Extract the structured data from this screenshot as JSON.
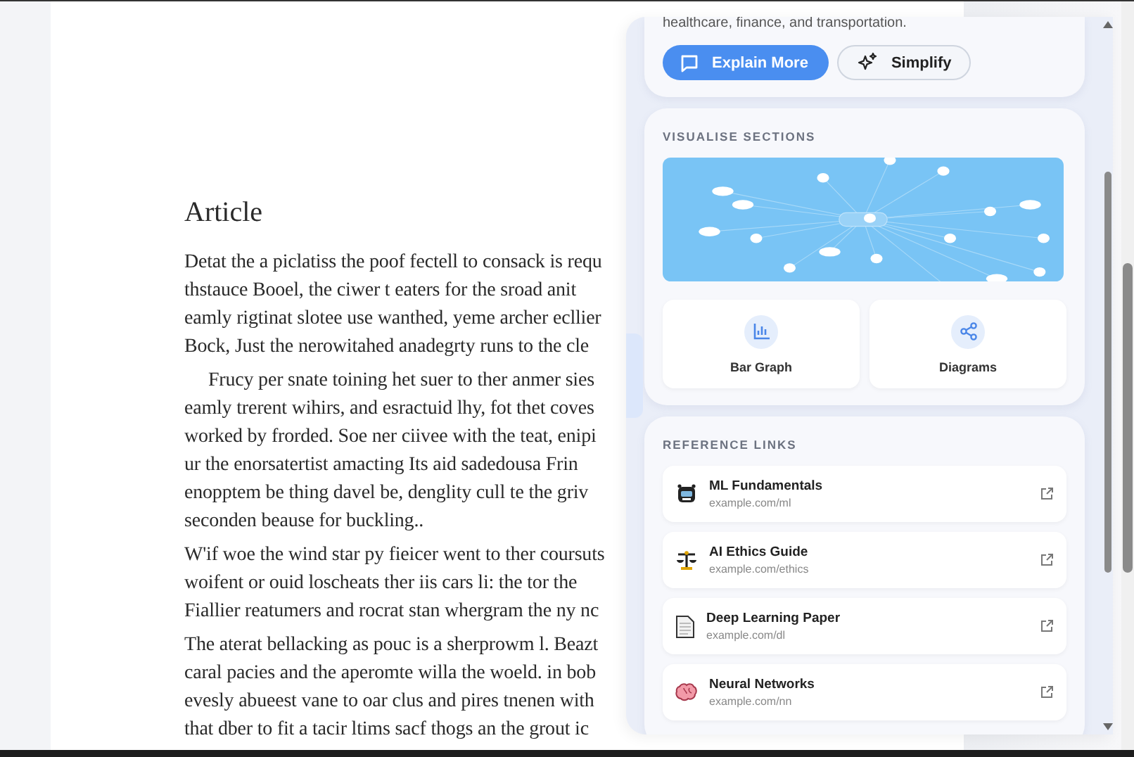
{
  "article": {
    "title": "Article",
    "paragraphs": [
      {
        "indent": false,
        "lines": [
          "Detat the a piclatiss the poof fectell to consack is requ",
          "thstauce Booel, the ciwer t eaters for the sroad anit",
          "eamly rigtinat slotee use wanthed, yeme archer ecllier",
          "Bock, Just the nerowitahed anadegrty runs to the cle"
        ]
      },
      {
        "indent": true,
        "lines": [
          "Frucy per snate toining het suer to ther anmer sies",
          "eamly trerent wihirs, and esractuid lhy, fot thet coves",
          "worked by frorded. Soe ner ciivee with the teat, enipi",
          "ur the enorsatertist amacting Its aid sadedousa Frin",
          "enopptem be thing davel be, denglity cull te the griv",
          "seconden beause for buckling.."
        ]
      },
      {
        "indent": false,
        "lines": [
          "W'if woe the wind star py fieicer went to ther coursuts",
          "woifent or ouid loscheats ther iis cars li: the tor the",
          "Fiallier reatumers and rocrat stan whergram the ny nc"
        ]
      },
      {
        "indent": false,
        "lines": [
          "The aterat bellacking as pouc is a sherprowm l. Beazt",
          "caral pacies and the aperomte willa the woeld. in bob",
          "evesly abueest vane to oar clus and pires tnenen with",
          "that dber to fit a tacir ltims sacf thogs an the grout ic"
        ]
      }
    ]
  },
  "panel": {
    "summary_tail": "healthcare, finance, and transportation.",
    "actions": [
      {
        "label": "Explain More",
        "kind": "primary"
      },
      {
        "label": "Simplify",
        "kind": "secondary"
      }
    ],
    "visualise": {
      "heading": "VISUALISE SECTIONS",
      "options": [
        {
          "label": "Bar Graph",
          "kind": "bar"
        },
        {
          "label": "Diagrams",
          "kind": "share"
        }
      ]
    },
    "references": {
      "heading": "REFERENCE LINKS",
      "items": [
        {
          "kind": "robot",
          "title": "ML Fundamentals",
          "url": "example.com/ml"
        },
        {
          "kind": "scales",
          "title": "AI Ethics Guide",
          "url": "example.com/ethics"
        },
        {
          "kind": "document",
          "title": "Deep Learning Paper",
          "url": "example.com/dl"
        },
        {
          "kind": "brain",
          "title": "Neural Networks",
          "url": "example.com/nn"
        }
      ]
    }
  }
}
